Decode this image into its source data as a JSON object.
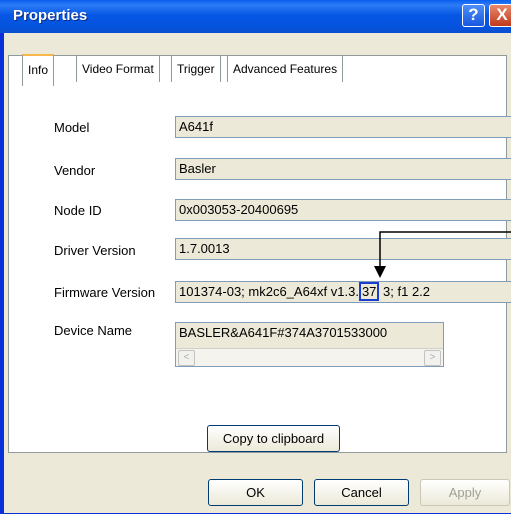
{
  "window": {
    "title": "Properties",
    "help_glyph": "?",
    "close_glyph": "X"
  },
  "tabs": [
    {
      "label": "Info"
    },
    {
      "label": "Video Format"
    },
    {
      "label": "Trigger"
    },
    {
      "label": "Advanced Features"
    }
  ],
  "info": {
    "model": {
      "label": "Model",
      "value": "A641f"
    },
    "vendor": {
      "label": "Vendor",
      "value": "Basler"
    },
    "node_id": {
      "label": "Node ID",
      "value": "0x003053-20400695"
    },
    "driver_version": {
      "label": "Driver Version",
      "value": "1.7.0013"
    },
    "firmware_version": {
      "label": "Firmware Version",
      "value_before": "101374-03; mk2c6_A64xf v1.3.",
      "value_highlight": "37",
      "value_after": " 3; f1 2.2"
    },
    "device_name": {
      "label": "Device Name",
      "value": "BASLER&A641F#374A3701533000"
    }
  },
  "buttons": {
    "copy": "Copy to clipboard",
    "ok": "OK",
    "cancel": "Cancel",
    "apply": "Apply"
  },
  "scroll": {
    "left_glyph": "<",
    "right_glyph": ">"
  }
}
